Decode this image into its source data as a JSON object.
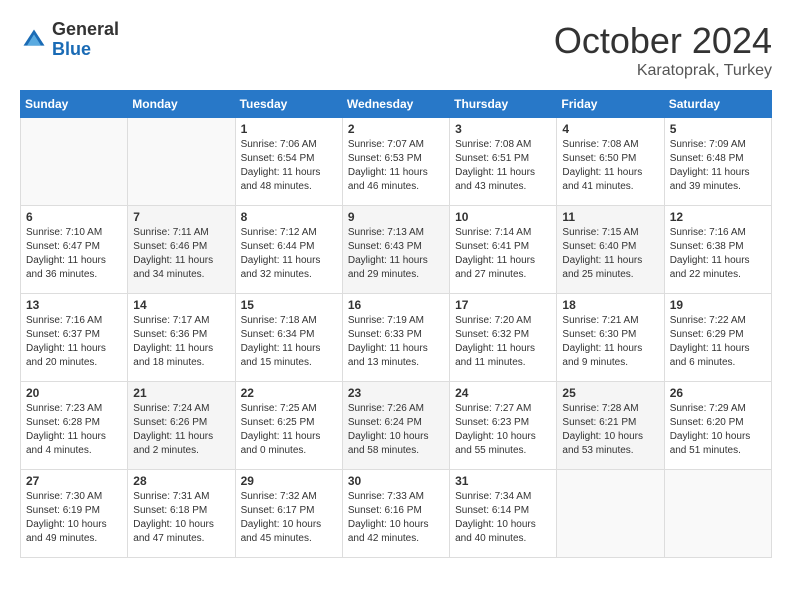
{
  "header": {
    "logo_general": "General",
    "logo_blue": "Blue",
    "month": "October 2024",
    "location": "Karatoprak, Turkey"
  },
  "days_of_week": [
    "Sunday",
    "Monday",
    "Tuesday",
    "Wednesday",
    "Thursday",
    "Friday",
    "Saturday"
  ],
  "weeks": [
    [
      {
        "day": "",
        "sunrise": "",
        "sunset": "",
        "daylight": ""
      },
      {
        "day": "",
        "sunrise": "",
        "sunset": "",
        "daylight": ""
      },
      {
        "day": "1",
        "sunrise": "Sunrise: 7:06 AM",
        "sunset": "Sunset: 6:54 PM",
        "daylight": "Daylight: 11 hours and 48 minutes."
      },
      {
        "day": "2",
        "sunrise": "Sunrise: 7:07 AM",
        "sunset": "Sunset: 6:53 PM",
        "daylight": "Daylight: 11 hours and 46 minutes."
      },
      {
        "day": "3",
        "sunrise": "Sunrise: 7:08 AM",
        "sunset": "Sunset: 6:51 PM",
        "daylight": "Daylight: 11 hours and 43 minutes."
      },
      {
        "day": "4",
        "sunrise": "Sunrise: 7:08 AM",
        "sunset": "Sunset: 6:50 PM",
        "daylight": "Daylight: 11 hours and 41 minutes."
      },
      {
        "day": "5",
        "sunrise": "Sunrise: 7:09 AM",
        "sunset": "Sunset: 6:48 PM",
        "daylight": "Daylight: 11 hours and 39 minutes."
      }
    ],
    [
      {
        "day": "6",
        "sunrise": "Sunrise: 7:10 AM",
        "sunset": "Sunset: 6:47 PM",
        "daylight": "Daylight: 11 hours and 36 minutes."
      },
      {
        "day": "7",
        "sunrise": "Sunrise: 7:11 AM",
        "sunset": "Sunset: 6:46 PM",
        "daylight": "Daylight: 11 hours and 34 minutes."
      },
      {
        "day": "8",
        "sunrise": "Sunrise: 7:12 AM",
        "sunset": "Sunset: 6:44 PM",
        "daylight": "Daylight: 11 hours and 32 minutes."
      },
      {
        "day": "9",
        "sunrise": "Sunrise: 7:13 AM",
        "sunset": "Sunset: 6:43 PM",
        "daylight": "Daylight: 11 hours and 29 minutes."
      },
      {
        "day": "10",
        "sunrise": "Sunrise: 7:14 AM",
        "sunset": "Sunset: 6:41 PM",
        "daylight": "Daylight: 11 hours and 27 minutes."
      },
      {
        "day": "11",
        "sunrise": "Sunrise: 7:15 AM",
        "sunset": "Sunset: 6:40 PM",
        "daylight": "Daylight: 11 hours and 25 minutes."
      },
      {
        "day": "12",
        "sunrise": "Sunrise: 7:16 AM",
        "sunset": "Sunset: 6:38 PM",
        "daylight": "Daylight: 11 hours and 22 minutes."
      }
    ],
    [
      {
        "day": "13",
        "sunrise": "Sunrise: 7:16 AM",
        "sunset": "Sunset: 6:37 PM",
        "daylight": "Daylight: 11 hours and 20 minutes."
      },
      {
        "day": "14",
        "sunrise": "Sunrise: 7:17 AM",
        "sunset": "Sunset: 6:36 PM",
        "daylight": "Daylight: 11 hours and 18 minutes."
      },
      {
        "day": "15",
        "sunrise": "Sunrise: 7:18 AM",
        "sunset": "Sunset: 6:34 PM",
        "daylight": "Daylight: 11 hours and 15 minutes."
      },
      {
        "day": "16",
        "sunrise": "Sunrise: 7:19 AM",
        "sunset": "Sunset: 6:33 PM",
        "daylight": "Daylight: 11 hours and 13 minutes."
      },
      {
        "day": "17",
        "sunrise": "Sunrise: 7:20 AM",
        "sunset": "Sunset: 6:32 PM",
        "daylight": "Daylight: 11 hours and 11 minutes."
      },
      {
        "day": "18",
        "sunrise": "Sunrise: 7:21 AM",
        "sunset": "Sunset: 6:30 PM",
        "daylight": "Daylight: 11 hours and 9 minutes."
      },
      {
        "day": "19",
        "sunrise": "Sunrise: 7:22 AM",
        "sunset": "Sunset: 6:29 PM",
        "daylight": "Daylight: 11 hours and 6 minutes."
      }
    ],
    [
      {
        "day": "20",
        "sunrise": "Sunrise: 7:23 AM",
        "sunset": "Sunset: 6:28 PM",
        "daylight": "Daylight: 11 hours and 4 minutes."
      },
      {
        "day": "21",
        "sunrise": "Sunrise: 7:24 AM",
        "sunset": "Sunset: 6:26 PM",
        "daylight": "Daylight: 11 hours and 2 minutes."
      },
      {
        "day": "22",
        "sunrise": "Sunrise: 7:25 AM",
        "sunset": "Sunset: 6:25 PM",
        "daylight": "Daylight: 11 hours and 0 minutes."
      },
      {
        "day": "23",
        "sunrise": "Sunrise: 7:26 AM",
        "sunset": "Sunset: 6:24 PM",
        "daylight": "Daylight: 10 hours and 58 minutes."
      },
      {
        "day": "24",
        "sunrise": "Sunrise: 7:27 AM",
        "sunset": "Sunset: 6:23 PM",
        "daylight": "Daylight: 10 hours and 55 minutes."
      },
      {
        "day": "25",
        "sunrise": "Sunrise: 7:28 AM",
        "sunset": "Sunset: 6:21 PM",
        "daylight": "Daylight: 10 hours and 53 minutes."
      },
      {
        "day": "26",
        "sunrise": "Sunrise: 7:29 AM",
        "sunset": "Sunset: 6:20 PM",
        "daylight": "Daylight: 10 hours and 51 minutes."
      }
    ],
    [
      {
        "day": "27",
        "sunrise": "Sunrise: 7:30 AM",
        "sunset": "Sunset: 6:19 PM",
        "daylight": "Daylight: 10 hours and 49 minutes."
      },
      {
        "day": "28",
        "sunrise": "Sunrise: 7:31 AM",
        "sunset": "Sunset: 6:18 PM",
        "daylight": "Daylight: 10 hours and 47 minutes."
      },
      {
        "day": "29",
        "sunrise": "Sunrise: 7:32 AM",
        "sunset": "Sunset: 6:17 PM",
        "daylight": "Daylight: 10 hours and 45 minutes."
      },
      {
        "day": "30",
        "sunrise": "Sunrise: 7:33 AM",
        "sunset": "Sunset: 6:16 PM",
        "daylight": "Daylight: 10 hours and 42 minutes."
      },
      {
        "day": "31",
        "sunrise": "Sunrise: 7:34 AM",
        "sunset": "Sunset: 6:14 PM",
        "daylight": "Daylight: 10 hours and 40 minutes."
      },
      {
        "day": "",
        "sunrise": "",
        "sunset": "",
        "daylight": ""
      },
      {
        "day": "",
        "sunrise": "",
        "sunset": "",
        "daylight": ""
      }
    ]
  ]
}
